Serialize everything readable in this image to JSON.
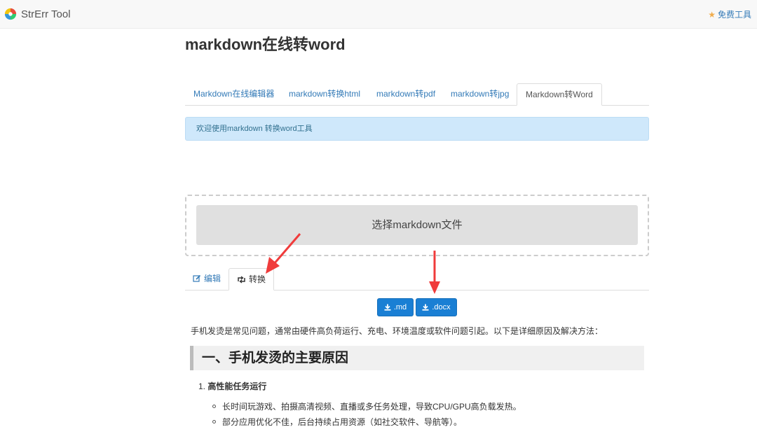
{
  "navbar": {
    "brand": "StrErr Tool",
    "logo_icon": "pinwheel-logo-icon",
    "free_tools": "免费工具",
    "free_tools_icon": "star-icon"
  },
  "page_title": "markdown在线转word",
  "top_tabs": [
    {
      "label": "Markdown在线编辑器",
      "active": false
    },
    {
      "label": "markdown转换html",
      "active": false
    },
    {
      "label": "markdown转pdf",
      "active": false
    },
    {
      "label": "markdown转jpg",
      "active": false
    },
    {
      "label": "Markdown转Word",
      "active": true
    }
  ],
  "alert": "欢迎使用markdown 转换word工具",
  "upload": {
    "button_label": "选择markdown文件"
  },
  "lower_tabs": {
    "edit": {
      "label": "编辑",
      "icon": "edit-icon",
      "active": false
    },
    "convert": {
      "label": "转换",
      "icon": "retweet-icon",
      "active": true
    }
  },
  "downloads": {
    "md": {
      "label": ".md",
      "icon": "download-icon"
    },
    "docx": {
      "label": ".docx",
      "icon": "download-icon"
    }
  },
  "content": {
    "intro": "手机发烫是常见问题，通常由硬件高负荷运行、充电、环境温度或软件问题引起。以下是详细原因及解决方法：",
    "heading": "一、手机发烫的主要原因",
    "list_number": "1.",
    "list_item": "高性能任务运行",
    "bullets": [
      "长时间玩游戏、拍摄高清视频、直播或多任务处理，导致CPU/GPU高负载发热。",
      "部分应用优化不佳，后台持续占用资源（如社交软件、导航等）。"
    ]
  },
  "colors": {
    "link": "#337ab7",
    "primary_button": "#1a7fd4",
    "alert_bg": "#cfe8fb",
    "annotation_arrow": "#f03b3b",
    "star": "#f0ad4e"
  }
}
